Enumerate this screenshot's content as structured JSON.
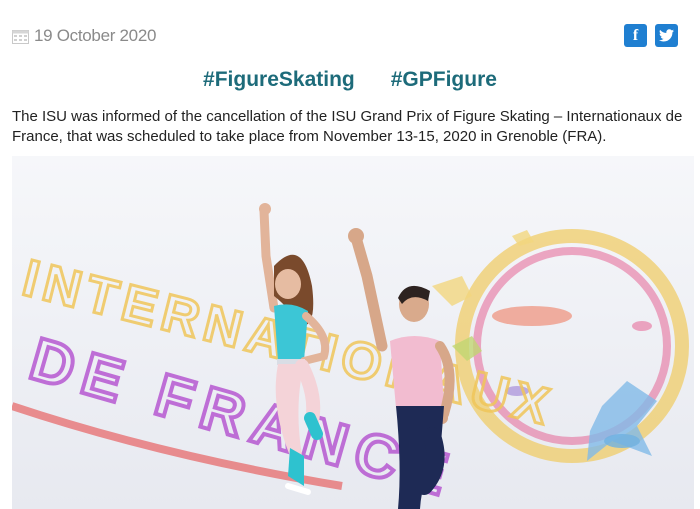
{
  "article": {
    "date": "19 October 2020",
    "hashtags": [
      "#FigureSkating",
      "#GPFigure"
    ],
    "summary": "The ISU was informed of the cancellation of the ISU Grand Prix of Figure Skating – Internationaux de France, that was scheduled to take place from November 13-15, 2020 in Grenoble (FRA)."
  },
  "social": {
    "facebook_icon": "facebook-icon",
    "twitter_icon": "twitter-icon",
    "facebook_glyph": "f"
  },
  "photo": {
    "ice_text_top": "INTERNATIONAUX",
    "ice_text_bottom": "DE FRANCE",
    "colors": {
      "ice": "#eef0f5",
      "skater_left_top": "#3cc6d6",
      "skater_right_top": "#f2bcd0",
      "skater_right_pants": "#1e2a55"
    }
  }
}
